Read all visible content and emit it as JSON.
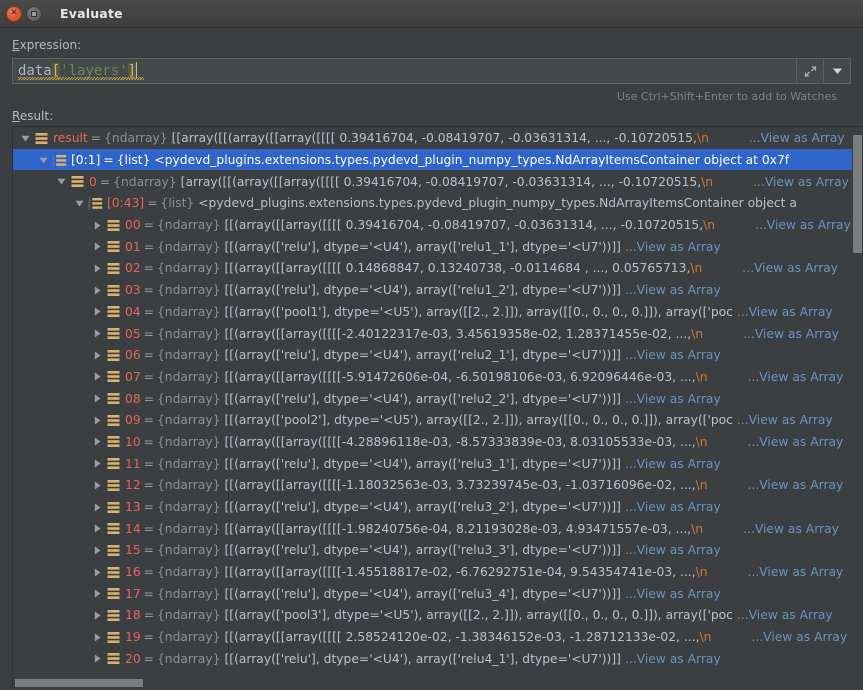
{
  "window": {
    "title": "Evaluate",
    "close_icon": "close-icon",
    "maximize_icon": "maximize-icon"
  },
  "expression": {
    "label": "Expression:",
    "label_mnemonic": "E",
    "label_rest": "xpression:",
    "value": "data['layers']",
    "tokens": {
      "ident": "data",
      "open_bracket": "[",
      "string": "'layers'",
      "close_bracket": "]"
    },
    "expand_icon": "expand-editor-icon",
    "history_icon": "chevron-down-icon",
    "hint": "Use Ctrl+Shift+Enter to add to Watches"
  },
  "result": {
    "label": "Result:",
    "label_mnemonic": "R",
    "label_rest": "esult:",
    "view_link": "...View as Array",
    "type_ndarray": "{ndarray}",
    "type_list": "{list}",
    "rows": [
      {
        "indent": 0,
        "twisty": "expanded",
        "icon": "ndarray-icon",
        "name": "result",
        "type": "{ndarray}",
        "value": "[[array([[(array([[array([[[[ 0.39416704, -0.08419707, -0.03631314, ..., -0.10720515,",
        "escape": "\\n",
        "link": "...View as Array",
        "link_gapped": true,
        "selected": false
      },
      {
        "indent": 1,
        "twisty": "expanded",
        "icon": "list-icon",
        "name": "[0:1]",
        "type": "{list}",
        "value": "<pydevd_plugins.extensions.types.pydevd_plugin_numpy_types.NdArrayItemsContainer object at 0x7f",
        "escape": "",
        "link": "",
        "link_gapped": false,
        "selected": true
      },
      {
        "indent": 2,
        "twisty": "expanded",
        "icon": "ndarray-icon",
        "name": "0",
        "type": "{ndarray}",
        "value": "[array([[(array([[array([[[[ 0.39416704, -0.08419707, -0.03631314, ..., -0.10720515,",
        "escape": "\\n",
        "link": "...View as Array",
        "link_gapped": true,
        "selected": false
      },
      {
        "indent": 3,
        "twisty": "expanded",
        "icon": "list-icon",
        "name": "[0:43]",
        "type": "{list}",
        "value": "<pydevd_plugins.extensions.types.pydevd_plugin_numpy_types.NdArrayItemsContainer object a",
        "escape": "",
        "link": "",
        "link_gapped": false,
        "selected": false
      },
      {
        "indent": 4,
        "twisty": "collapsed",
        "icon": "ndarray-icon",
        "name": "00",
        "type": "{ndarray}",
        "value": "[[(array([[array([[[[ 0.39416704, -0.08419707, -0.03631314, ..., -0.10720515,",
        "escape": "\\n",
        "link": "...View as Array",
        "link_gapped": true,
        "selected": false
      },
      {
        "indent": 4,
        "twisty": "collapsed",
        "icon": "ndarray-icon",
        "name": "01",
        "type": "{ndarray}",
        "value": "[[(array(['relu'], dtype='<U4'), array(['relu1_1'], dtype='<U7'))]]",
        "escape": "",
        "link": "...View as Array",
        "link_gapped": false,
        "selected": false
      },
      {
        "indent": 4,
        "twisty": "collapsed",
        "icon": "ndarray-icon",
        "name": "02",
        "type": "{ndarray}",
        "value": "[[(array([[array([[[[ 0.14868847,  0.13240738, -0.0114684 , ...,  0.05765713,",
        "escape": "\\n",
        "link": "...View as Array",
        "link_gapped": true,
        "selected": false
      },
      {
        "indent": 4,
        "twisty": "collapsed",
        "icon": "ndarray-icon",
        "name": "03",
        "type": "{ndarray}",
        "value": "[[(array(['relu'], dtype='<U4'), array(['relu1_2'], dtype='<U7'))]]",
        "escape": "",
        "link": "...View as Array",
        "link_gapped": false,
        "selected": false
      },
      {
        "indent": 4,
        "twisty": "collapsed",
        "icon": "ndarray-icon",
        "name": "04",
        "type": "{ndarray}",
        "value": "[[(array(['pool1'], dtype='<U5'), array([[2., 2.]]), array([[0., 0., 0., 0.]]), array(['poc",
        "escape": "",
        "link": "...View as Array",
        "link_gapped": false,
        "selected": false
      },
      {
        "indent": 4,
        "twisty": "collapsed",
        "icon": "ndarray-icon",
        "name": "05",
        "type": "{ndarray}",
        "value": "[[(array([[array([[[[-2.40122317e-03,  3.45619358e-02,  1.28371455e-02, ...,",
        "escape": "\\n",
        "link": "...View as Array",
        "link_gapped": true,
        "selected": false
      },
      {
        "indent": 4,
        "twisty": "collapsed",
        "icon": "ndarray-icon",
        "name": "06",
        "type": "{ndarray}",
        "value": "[[(array(['relu'], dtype='<U4'), array(['relu2_1'], dtype='<U7'))]]",
        "escape": "",
        "link": "...View as Array",
        "link_gapped": false,
        "selected": false
      },
      {
        "indent": 4,
        "twisty": "collapsed",
        "icon": "ndarray-icon",
        "name": "07",
        "type": "{ndarray}",
        "value": "[[(array([[array([[[[-5.91472606e-04, -6.50198106e-03,  6.92096446e-03, ...,",
        "escape": "\\n",
        "link": "...View as Array",
        "link_gapped": true,
        "selected": false
      },
      {
        "indent": 4,
        "twisty": "collapsed",
        "icon": "ndarray-icon",
        "name": "08",
        "type": "{ndarray}",
        "value": "[[(array(['relu'], dtype='<U4'), array(['relu2_2'], dtype='<U7'))]]",
        "escape": "",
        "link": "...View as Array",
        "link_gapped": false,
        "selected": false
      },
      {
        "indent": 4,
        "twisty": "collapsed",
        "icon": "ndarray-icon",
        "name": "09",
        "type": "{ndarray}",
        "value": "[[(array(['pool2'], dtype='<U5'), array([[2., 2.]]), array([[0., 0., 0., 0.]]), array(['poc",
        "escape": "",
        "link": "...View as Array",
        "link_gapped": false,
        "selected": false
      },
      {
        "indent": 4,
        "twisty": "collapsed",
        "icon": "ndarray-icon",
        "name": "10",
        "type": "{ndarray}",
        "value": "[[(array([[array([[[[-4.28896118e-03, -8.57333839e-03,  8.03105533e-03, ...,",
        "escape": "\\n",
        "link": "...View as Array",
        "link_gapped": true,
        "selected": false
      },
      {
        "indent": 4,
        "twisty": "collapsed",
        "icon": "ndarray-icon",
        "name": "11",
        "type": "{ndarray}",
        "value": "[[(array(['relu'], dtype='<U4'), array(['relu3_1'], dtype='<U7'))]]",
        "escape": "",
        "link": "...View as Array",
        "link_gapped": false,
        "selected": false
      },
      {
        "indent": 4,
        "twisty": "collapsed",
        "icon": "ndarray-icon",
        "name": "12",
        "type": "{ndarray}",
        "value": "[[(array([[array([[[[-1.18032563e-03,  3.73239745e-03, -1.03716096e-02, ...,",
        "escape": "\\n",
        "link": "...View as Array",
        "link_gapped": true,
        "selected": false
      },
      {
        "indent": 4,
        "twisty": "collapsed",
        "icon": "ndarray-icon",
        "name": "13",
        "type": "{ndarray}",
        "value": "[[(array(['relu'], dtype='<U4'), array(['relu3_2'], dtype='<U7'))]]",
        "escape": "",
        "link": "...View as Array",
        "link_gapped": false,
        "selected": false
      },
      {
        "indent": 4,
        "twisty": "collapsed",
        "icon": "ndarray-icon",
        "name": "14",
        "type": "{ndarray}",
        "value": "[[(array([[array([[[[-1.98240756e-04,  8.21193028e-03,  4.93471557e-03, ...,",
        "escape": "\\n",
        "link": "...View as Array",
        "link_gapped": true,
        "selected": false
      },
      {
        "indent": 4,
        "twisty": "collapsed",
        "icon": "ndarray-icon",
        "name": "15",
        "type": "{ndarray}",
        "value": "[[(array(['relu'], dtype='<U4'), array(['relu3_3'], dtype='<U7'))]]",
        "escape": "",
        "link": "...View as Array",
        "link_gapped": false,
        "selected": false
      },
      {
        "indent": 4,
        "twisty": "collapsed",
        "icon": "ndarray-icon",
        "name": "16",
        "type": "{ndarray}",
        "value": "[[(array([[array([[[[-1.45518817e-02, -6.76292751e-04,  9.54354741e-03, ...,",
        "escape": "\\n",
        "link": "...View as Array",
        "link_gapped": true,
        "selected": false
      },
      {
        "indent": 4,
        "twisty": "collapsed",
        "icon": "ndarray-icon",
        "name": "17",
        "type": "{ndarray}",
        "value": "[[(array(['relu'], dtype='<U4'), array(['relu3_4'], dtype='<U7'))]]",
        "escape": "",
        "link": "...View as Array",
        "link_gapped": false,
        "selected": false
      },
      {
        "indent": 4,
        "twisty": "collapsed",
        "icon": "ndarray-icon",
        "name": "18",
        "type": "{ndarray}",
        "value": "[[(array(['pool3'], dtype='<U5'), array([[2., 2.]]), array([[0., 0., 0., 0.]]), array(['poc",
        "escape": "",
        "link": "...View as Array",
        "link_gapped": false,
        "selected": false
      },
      {
        "indent": 4,
        "twisty": "collapsed",
        "icon": "ndarray-icon",
        "name": "19",
        "type": "{ndarray}",
        "value": "[[(array([[array([[[[ 2.58524120e-02, -1.38346152e-03, -1.28712133e-02, ...,",
        "escape": "\\n",
        "link": "...View as Array",
        "link_gapped": true,
        "selected": false
      },
      {
        "indent": 4,
        "twisty": "collapsed",
        "icon": "ndarray-icon",
        "name": "20",
        "type": "{ndarray}",
        "value": "[[(array(['relu'], dtype='<U4'), array(['relu4_1'], dtype='<U7'))]]",
        "escape": "",
        "link": "...View as Array",
        "link_gapped": false,
        "selected": false
      }
    ]
  },
  "colors": {
    "background": "#3c3f41",
    "selection": "#2f65ca",
    "key_name": "#e8655a",
    "value_text": "#b8c2cc",
    "type_text": "#8c9196",
    "link": "#6894c4",
    "escape": "#cc7832",
    "icon_ndarray": "#d9b270",
    "string_token": "#6a8759"
  }
}
